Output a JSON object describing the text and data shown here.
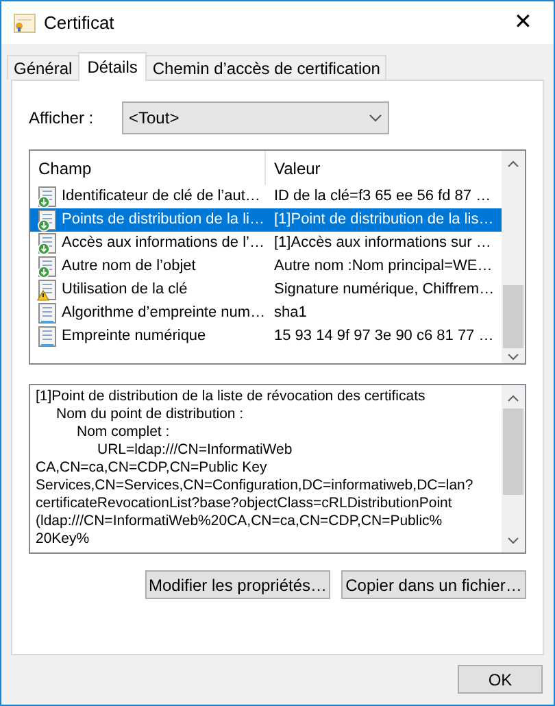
{
  "window": {
    "title": "Certificat",
    "close": "✕"
  },
  "tabs": [
    {
      "label": "Général",
      "selected": false
    },
    {
      "label": "Détails",
      "selected": true
    },
    {
      "label": "Chemin d’accès de certification",
      "selected": false
    }
  ],
  "show": {
    "label": "Afficher :",
    "value": "<Tout>"
  },
  "fields_table": {
    "columns": [
      "Champ",
      "Valeur"
    ],
    "rows": [
      {
        "kind": "extension",
        "field": "Identificateur de clé de l’aut…",
        "value": "ID de la clé=f3 65 ee 56 fd 87 …",
        "selected": false
      },
      {
        "kind": "extension",
        "field": "Points de distribution de la li…",
        "value": "[1]Point de distribution de la lis…",
        "selected": true
      },
      {
        "kind": "extension",
        "field": "Accès aux informations de l’…",
        "value": "[1]Accès aux informations sur …",
        "selected": false
      },
      {
        "kind": "extension",
        "field": "Autre nom de l’objet",
        "value": "Autre nom :Nom principal=WE…",
        "selected": false
      },
      {
        "kind": "critical",
        "field": "Utilisation de la clé",
        "value": "Signature numérique, Chiffrem…",
        "selected": false
      },
      {
        "kind": "property",
        "field": "Algorithme d’empreinte num…",
        "value": "sha1",
        "selected": false
      },
      {
        "kind": "property",
        "field": "Empreinte numérique",
        "value": "15 93 14 9f 97 3e 90 c6 81 77 …",
        "selected": false
      }
    ]
  },
  "detail": {
    "lines": [
      {
        "text": "[1]Point de distribution de la liste de révocation des certificats",
        "children": [
          {
            "text": "Nom du point de distribution :",
            "children": [
              {
                "text": "Nom complet :",
                "children": [
                  {
                    "text": "URL=ldap:///CN=InformatiWeb"
                  }
                ]
              }
            ]
          }
        ]
      },
      {
        "text": "CA,CN=ca,CN=CDP,CN=Public Key"
      },
      {
        "text": "Services,CN=Services,CN=Configuration,DC=informatiweb,DC=lan?"
      },
      {
        "text": "certificateRevocationList?base?objectClass=cRLDistributionPoint"
      },
      {
        "text": "(ldap:///CN=InformatiWeb%20CA,CN=ca,CN=CDP,CN=Public%"
      },
      {
        "text": "20Key%"
      }
    ]
  },
  "buttons": [
    "Modifier les propriétés…",
    "Copier dans un fichier…"
  ],
  "ok_button": "OK"
}
